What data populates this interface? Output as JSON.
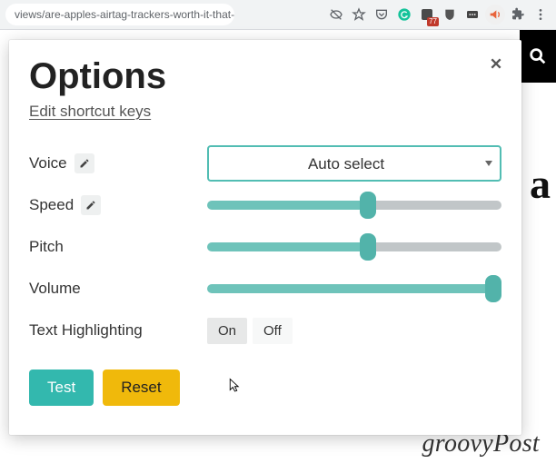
{
  "browser": {
    "url_fragment": "views/are-apples-airtag-trackers-worth-it-that-d...",
    "badge_count": "77"
  },
  "page_behind": {
    "peek_char": "a",
    "brand": "groovyPost"
  },
  "panel": {
    "title": "Options",
    "edit_shortcut_link": "Edit shortcut keys",
    "rows": {
      "voice_label": "Voice",
      "speed_label": "Speed",
      "pitch_label": "Pitch",
      "volume_label": "Volume",
      "highlight_label": "Text Highlighting"
    },
    "voice": {
      "selected": "Auto select"
    },
    "sliders": {
      "speed_pct": 55,
      "pitch_pct": 55,
      "volume_pct": 100
    },
    "highlight": {
      "on_label": "On",
      "off_label": "Off",
      "value": "on"
    },
    "buttons": {
      "test": "Test",
      "reset": "Reset"
    }
  }
}
